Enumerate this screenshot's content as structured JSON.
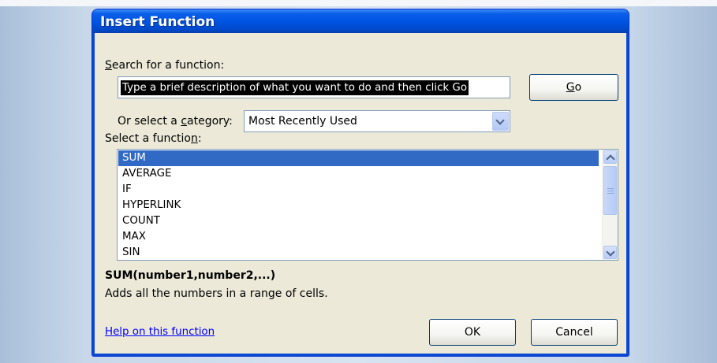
{
  "dialog": {
    "title": "Insert Function",
    "search_label_prefix": "S",
    "search_label_rest": "earch for a function:",
    "search_value": "Type a brief description of what you  want to do and then click Go",
    "go_label_u": "G",
    "go_label_rest": "o",
    "category_label_a": "Or select a ",
    "category_label_u": "c",
    "category_label_b": "ategory:",
    "category_selected": "Most Recently Used",
    "functions_label_a": "Select a functio",
    "functions_label_u": "n",
    "functions_label_b": ":",
    "functions": [
      "SUM",
      "AVERAGE",
      "IF",
      "HYPERLINK",
      "COUNT",
      "MAX",
      "SIN"
    ],
    "selected_function": "SUM",
    "syntax": "SUM(number1,number2,...)",
    "description": "Adds all the numbers in a range of cells.",
    "help_link": "Help on this function",
    "ok_label": "OK",
    "cancel_label": "Cancel"
  },
  "icons": {
    "dropdown": "chevron-down-icon",
    "scroll_up": "chevron-up-icon",
    "scroll_down": "chevron-down-icon"
  },
  "colors": {
    "titlebar": "#0054e3",
    "selection": "#316ac5",
    "dialog_bg": "#ece9d8",
    "link": "#0000ff"
  }
}
